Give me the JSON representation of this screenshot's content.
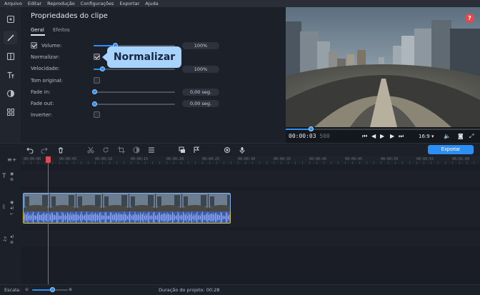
{
  "menu": [
    "Arquivo",
    "Editar",
    "Reprodução",
    "Configurações",
    "Exportar",
    "Ajuda"
  ],
  "left_tools": [
    {
      "icon": "import-icon",
      "active": false
    },
    {
      "icon": "magic-wand-icon",
      "active": true
    },
    {
      "icon": "filters-icon",
      "active": false
    },
    {
      "icon": "titles-icon",
      "active": false
    },
    {
      "icon": "transitions-icon",
      "active": false
    },
    {
      "icon": "more-tools-icon",
      "active": false
    }
  ],
  "properties": {
    "title": "Propriedades do clipe",
    "tabs": [
      "Geral",
      "Efeitos"
    ],
    "active_tab": "Geral",
    "volume": {
      "label": "Volume:",
      "checked": true,
      "value": "100%",
      "level": 1.0
    },
    "normalize": {
      "label": "Normalizar:",
      "checked": true
    },
    "speed": {
      "label": "Velocidade:",
      "value": "100%",
      "level": 0.12
    },
    "original_pitch": {
      "label": "Tom original:",
      "checked": false
    },
    "fade_in": {
      "label": "Fade in:",
      "value": "0,00 seg.",
      "level": 0
    },
    "fade_out": {
      "label": "Fade out:",
      "value": "0,00 seg.",
      "level": 0
    },
    "invert": {
      "label": "Inverter:",
      "checked": false
    }
  },
  "tooltip": {
    "text": "Normalizar"
  },
  "preview": {
    "help": "?",
    "timecode": "00:00:03",
    "timecode_frames": "500",
    "progress": 0.13,
    "ratio": "16:9 ▾"
  },
  "toolbar": {
    "export_label": "Exportar"
  },
  "ruler": [
    "00:00:00",
    "00:00:05",
    "00:00:10",
    "00:00:15",
    "00:00:20",
    "00:00:25",
    "00:00:30",
    "00:00:35",
    "00:00:40",
    "00:00:45",
    "00:00:50",
    "00:00:55",
    "00:01:00"
  ],
  "status": {
    "scale_label": "Escala:",
    "duration": "Duração do projeto: 00:28",
    "scale_level": 0.5
  },
  "colors": {
    "accent": "#2b8ff5",
    "playhead": "#e5484d",
    "tooltip": "#a8d3ff"
  }
}
